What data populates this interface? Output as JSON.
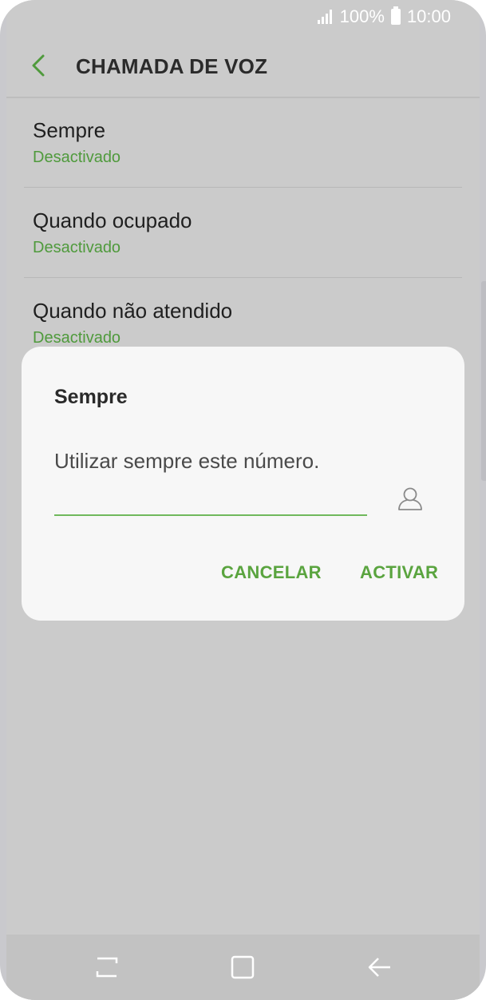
{
  "status_bar": {
    "battery_text": "100%",
    "time": "10:00"
  },
  "header": {
    "title": "CHAMADA DE VOZ",
    "back_icon": "chevron-left-icon"
  },
  "list": {
    "items": [
      {
        "title": "Sempre",
        "subtitle": "Desactivado"
      },
      {
        "title": "Quando ocupado",
        "subtitle": "Desactivado"
      },
      {
        "title": "Quando não atendido",
        "subtitle": "Desactivado"
      }
    ]
  },
  "dialog": {
    "title": "Sempre",
    "message": "Utilizar sempre este número.",
    "input_value": "",
    "contact_icon": "contact-person-icon",
    "cancel_label": "CANCELAR",
    "activate_label": "ACTIVAR"
  },
  "nav_bar": {
    "recents_icon": "recents-icon",
    "home_icon": "home-icon",
    "back_icon": "back-arrow-icon"
  },
  "colors": {
    "accent": "#5aa43f",
    "subtitle": "#4f9a3c",
    "scrim": "#cbcbcb",
    "dialog_bg": "#f7f7f7"
  }
}
